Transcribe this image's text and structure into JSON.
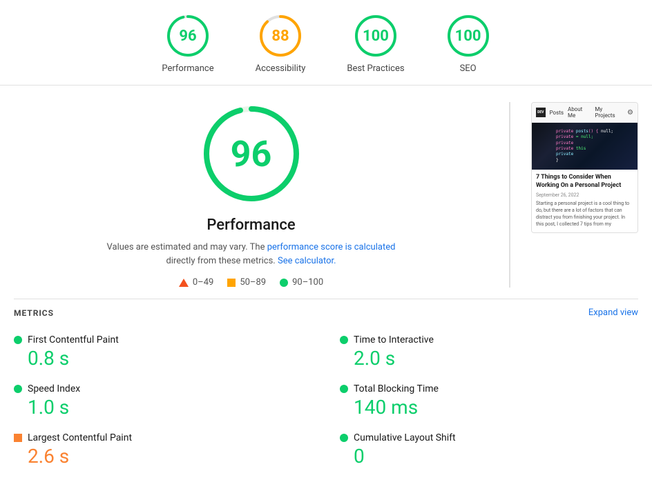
{
  "scores": [
    {
      "id": "performance",
      "label": "Performance",
      "value": 96,
      "color": "#0cce6b",
      "strokeColor": "#0cce6b",
      "pct": 0.96
    },
    {
      "id": "accessibility",
      "label": "Accessibility",
      "value": 88,
      "color": "#ffa400",
      "strokeColor": "#ffa400",
      "pct": 0.88
    },
    {
      "id": "best-practices",
      "label": "Best Practices",
      "value": 100,
      "color": "#0cce6b",
      "strokeColor": "#0cce6b",
      "pct": 1.0
    },
    {
      "id": "seo",
      "label": "SEO",
      "value": 100,
      "color": "#0cce6b",
      "strokeColor": "#0cce6b",
      "pct": 1.0
    }
  ],
  "main": {
    "big_score": 96,
    "title": "Performance",
    "desc_part1": "Values are estimated and may vary. The ",
    "desc_link1": "performance score is calculated",
    "desc_part2": " directly from these metrics. ",
    "desc_link2": "See calculator.",
    "legend": [
      {
        "type": "triangle",
        "range": "0–49"
      },
      {
        "type": "square",
        "color": "#ffa400",
        "range": "50–89"
      },
      {
        "type": "dot",
        "color": "#0cce6b",
        "range": "90–100"
      }
    ]
  },
  "preview": {
    "logo": "DEV",
    "nav_links": [
      "Posts",
      "About Me",
      "My Projects"
    ],
    "hero_lines": [
      "private posts() { null;",
      "private",
      "private",
      "private"
    ],
    "post_title": "7 Things to Consider When Working On a Personal Project",
    "date": "September 26, 2022",
    "body": "Starting a personal project is a cool thing to do, but there are a lot of factors that can distract you from finishing your project. In this post, I collected 7 tips from my"
  },
  "metrics": {
    "section_title": "METRICS",
    "expand_label": "Expand view",
    "items": [
      {
        "name": "First Contentful Paint",
        "value": "0.8 s",
        "color_class": "metric-value-green",
        "dot_color": "#0cce6b",
        "dot_type": "circle"
      },
      {
        "name": "Time to Interactive",
        "value": "2.0 s",
        "color_class": "metric-value-green",
        "dot_color": "#0cce6b",
        "dot_type": "circle"
      },
      {
        "name": "Speed Index",
        "value": "1.0 s",
        "color_class": "metric-value-green",
        "dot_color": "#0cce6b",
        "dot_type": "circle"
      },
      {
        "name": "Total Blocking Time",
        "value": "140 ms",
        "color_class": "metric-value-green",
        "dot_color": "#0cce6b",
        "dot_type": "circle"
      },
      {
        "name": "Largest Contentful Paint",
        "value": "2.6 s",
        "color_class": "metric-value-orange",
        "dot_color": "#fa8231",
        "dot_type": "square"
      },
      {
        "name": "Cumulative Layout Shift",
        "value": "0",
        "color_class": "metric-value-green",
        "dot_color": "#0cce6b",
        "dot_type": "circle"
      }
    ]
  }
}
